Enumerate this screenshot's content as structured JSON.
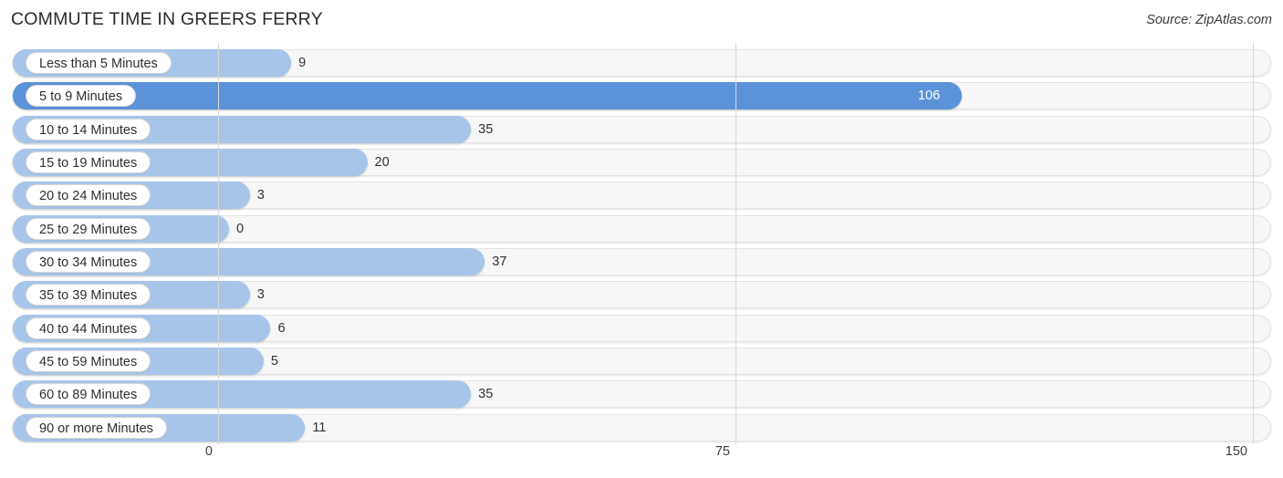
{
  "header": {
    "title": "COMMUTE TIME IN GREERS FERRY",
    "source": "Source: ZipAtlas.com"
  },
  "chart_data": {
    "type": "bar",
    "orientation": "horizontal",
    "title": "COMMUTE TIME IN GREERS FERRY",
    "xlabel": "",
    "ylabel": "",
    "xlim": [
      0,
      150
    ],
    "xticks": [
      0,
      75,
      150
    ],
    "xtick_labels": [
      "0",
      "75",
      "150"
    ],
    "grid": true,
    "legend": false,
    "highlight_rule": "max-value bar rendered in darker blue with value label inside the bar",
    "colors": {
      "bar": "#a6c5e9",
      "bar_highlight": "#5b92d8",
      "track": "#f7f7f7",
      "gridline": "#d8d8d8",
      "label_text": "#2f2f2f",
      "value_text": "#30303a",
      "value_text_inside": "#ffffff"
    },
    "categories": [
      "Less than 5 Minutes",
      "5 to 9 Minutes",
      "10 to 14 Minutes",
      "15 to 19 Minutes",
      "20 to 24 Minutes",
      "25 to 29 Minutes",
      "30 to 34 Minutes",
      "35 to 39 Minutes",
      "40 to 44 Minutes",
      "45 to 59 Minutes",
      "60 to 89 Minutes",
      "90 or more Minutes"
    ],
    "values": [
      9,
      106,
      35,
      20,
      3,
      0,
      37,
      3,
      6,
      5,
      35,
      11
    ],
    "value_labels": [
      "9",
      "106",
      "35",
      "20",
      "3",
      "0",
      "37",
      "3",
      "6",
      "5",
      "35",
      "11"
    ]
  },
  "rows": [
    {
      "label": "Less than 5 Minutes",
      "value": 9,
      "value_label": "9",
      "highlight": false
    },
    {
      "label": "5 to 9 Minutes",
      "value": 106,
      "value_label": "106",
      "highlight": true
    },
    {
      "label": "10 to 14 Minutes",
      "value": 35,
      "value_label": "35",
      "highlight": false
    },
    {
      "label": "15 to 19 Minutes",
      "value": 20,
      "value_label": "20",
      "highlight": false
    },
    {
      "label": "20 to 24 Minutes",
      "value": 3,
      "value_label": "3",
      "highlight": false
    },
    {
      "label": "25 to 29 Minutes",
      "value": 0,
      "value_label": "0",
      "highlight": false
    },
    {
      "label": "30 to 34 Minutes",
      "value": 37,
      "value_label": "37",
      "highlight": false
    },
    {
      "label": "35 to 39 Minutes",
      "value": 3,
      "value_label": "3",
      "highlight": false
    },
    {
      "label": "40 to 44 Minutes",
      "value": 6,
      "value_label": "6",
      "highlight": false
    },
    {
      "label": "45 to 59 Minutes",
      "value": 5,
      "value_label": "5",
      "highlight": false
    },
    {
      "label": "60 to 89 Minutes",
      "value": 35,
      "value_label": "35",
      "highlight": false
    },
    {
      "label": "90 or more Minutes",
      "value": 11,
      "value_label": "11",
      "highlight": false
    }
  ],
  "axis": {
    "ticks": [
      {
        "label": "0",
        "value": 0
      },
      {
        "label": "75",
        "value": 75
      },
      {
        "label": "150",
        "value": 150
      }
    ]
  }
}
